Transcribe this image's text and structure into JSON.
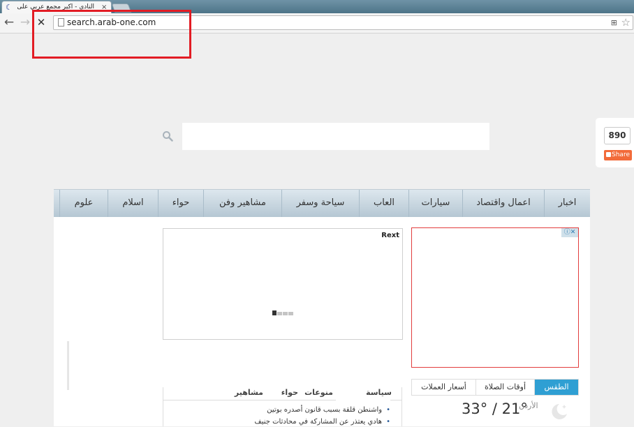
{
  "browser": {
    "tab_title": "النادي - اكبر مجمع عربي على الا",
    "tab_close": "×",
    "url": "search.arab-one.com",
    "icons": [
      "back-icon",
      "forward-icon",
      "stop-icon",
      "page-icon",
      "translate-icon",
      "star-icon"
    ]
  },
  "search": {
    "placeholder": ""
  },
  "share": {
    "count": "890",
    "label": "Share"
  },
  "nav": [
    "اخبار",
    "اعمال واقتصاد",
    "سيارات",
    "العاب",
    "سياحة وسفر",
    "مشاهير وفن",
    "حواء",
    "اسلام",
    "علوم"
  ],
  "ads": {
    "left_label": "Rext"
  },
  "news": {
    "tabs": [
      "سياسة",
      "منوعات",
      "حواء",
      "مشاهير"
    ],
    "items": [
      "واشنطن قلقة بسبب قانون أصدره بوتين",
      "هادي يعتذر عن المشاركة في محادثات جنيف"
    ]
  },
  "weather": {
    "tabs": {
      "weather": "الطقس",
      "prayer": "أوقات الصلاة",
      "currency": "أسعار العملات"
    },
    "temp": "33° / 21°",
    "city": "الأردن"
  },
  "colors": {
    "accent": "#2f9fd3",
    "highlight": "#e21c24",
    "share": "#f26b3a"
  }
}
